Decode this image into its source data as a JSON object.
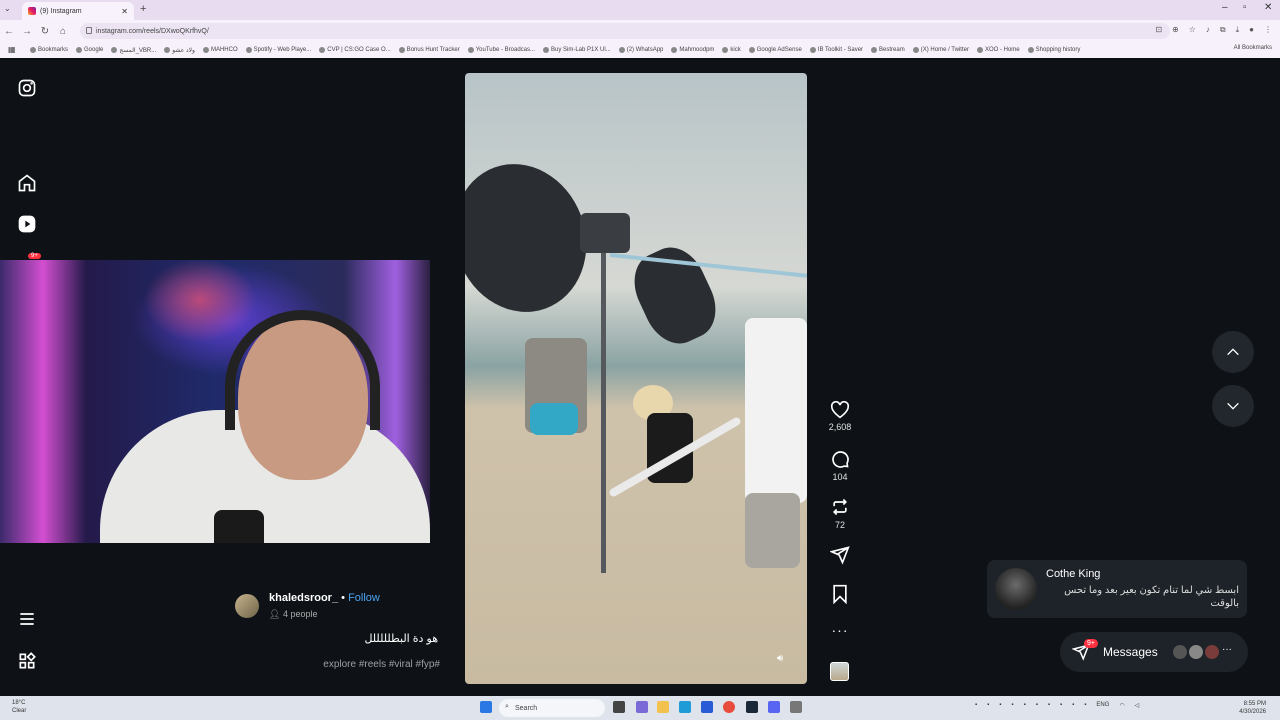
{
  "browser": {
    "tab_title": "(9) Instagram",
    "url": "instagram.com/reels/DXwoQKrfhvQ/",
    "bookmarks": [
      "Bookmarks",
      "Google",
      "المسج_VBR...",
      "ولاد عشو",
      "MAHHCO",
      "Spotify - Web Playe...",
      "CVP | CS:GO Case O...",
      "Bonus Hunt Tracker",
      "YouTube - Broadcas...",
      "Buy Sim-Lab P1X Ul...",
      "(2) WhatsApp",
      "Mahmoodpm",
      "kick",
      "Google AdSense",
      "IB Toolkit - Saver",
      "Bestream",
      "(X) Home / Twitter",
      "XOO - Home",
      "Shopping history"
    ],
    "all_bookmarks": "All Bookmarks"
  },
  "reel": {
    "author": "khaledsroor_",
    "separator": "•",
    "follow": "Follow",
    "people": "4 people",
    "caption": "هو دة البطلللللل",
    "tags": "explore #reels #viral #fyp#",
    "likes": "2,608",
    "comments": "104",
    "reposts": "72"
  },
  "notification": {
    "name": "Cothe King",
    "text": "ابسط شي لما تنام تكون بعير بعد وما تحس بالوقت"
  },
  "messages": {
    "label": "Messages",
    "badge": "9+"
  },
  "sidebar": {
    "badge": "9+"
  },
  "taskbar": {
    "search": "Search",
    "weather_temp": "18°C",
    "weather_desc": "Clear",
    "lang": "ENG",
    "time": "8:55 PM",
    "date": "4/30/2026"
  },
  "colors": {
    "follow": "#4aa3f0",
    "badge": "#ff3040",
    "page_bg": "#0e1217"
  }
}
